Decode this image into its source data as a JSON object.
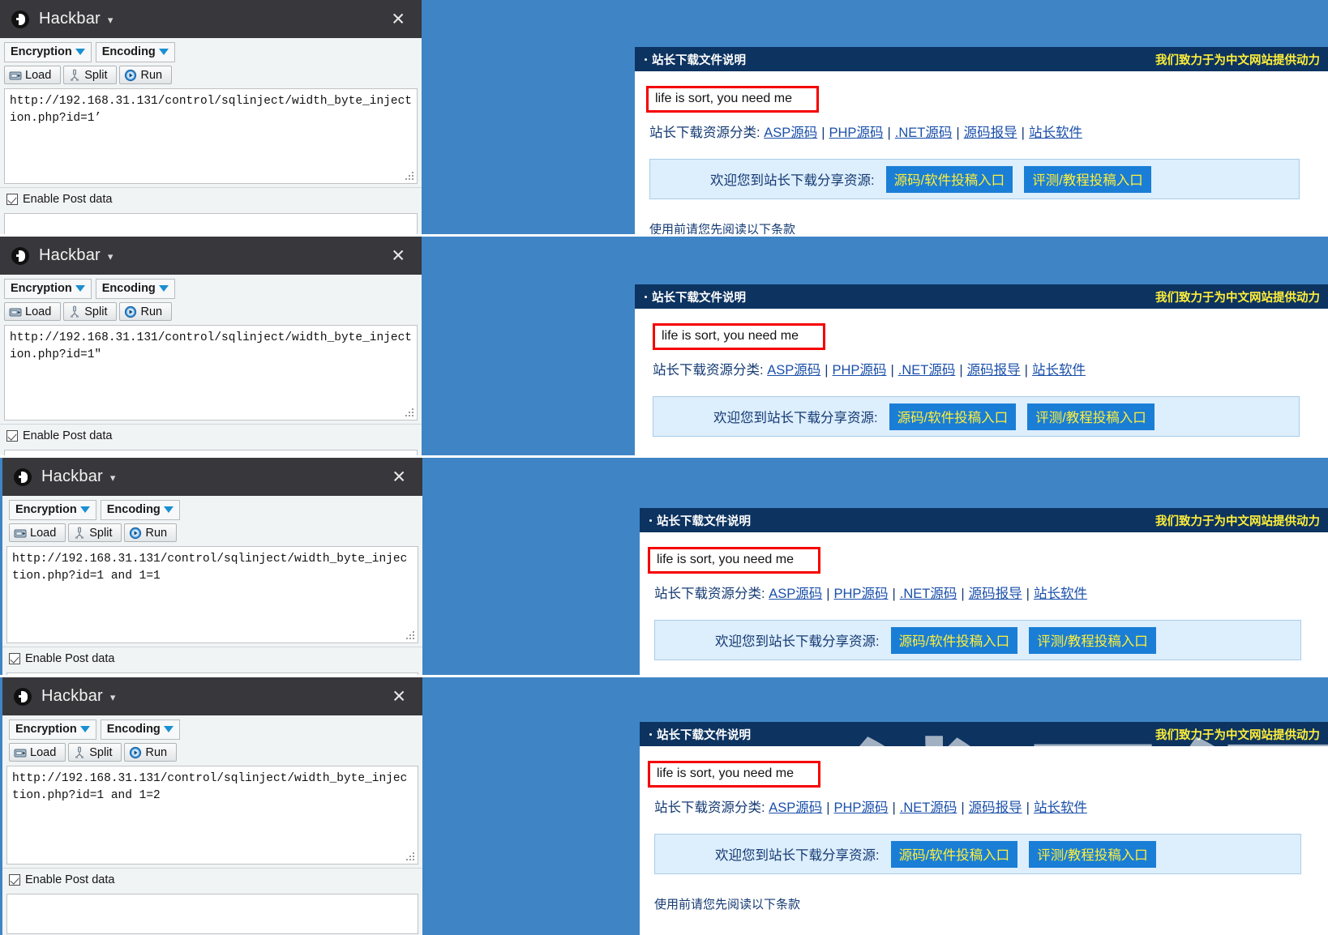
{
  "meta": {
    "background_color": "#3f85c6",
    "header_color": "#0d3360",
    "accent_yellow": "#ffef3a",
    "highlight_red": "#f50000"
  },
  "hackbar": {
    "title": "Hackbar",
    "caret_icon": "chevron-down-icon",
    "close_icon": "close-icon",
    "logo_icon": "hackbar-logo-icon",
    "dropdowns": [
      {
        "label": "Encryption",
        "icon": "caret-down-icon"
      },
      {
        "label": "Encoding",
        "icon": "caret-down-icon"
      }
    ],
    "buttons": [
      {
        "label": "Load",
        "icon": "load-icon"
      },
      {
        "label": "Split",
        "icon": "split-icon"
      },
      {
        "label": "Run",
        "icon": "run-icon"
      }
    ],
    "post_data_label": "Enable Post data",
    "post_data_checked": true
  },
  "webpage": {
    "header_title": "站长下载文件说明",
    "header_slogan": "我们致力于为中文网站提供动力",
    "flag_text": "life is sort, you need me",
    "category_label": "站长下载资源分类:",
    "category_links": [
      "ASP源码",
      "PHP源码",
      ".NET源码",
      "源码报导",
      "站长软件"
    ],
    "category_separator": "|",
    "promo_label": "欢迎您到站长下载分享资源:",
    "promo_buttons": [
      "源码/软件投稿入口",
      "评测/教程投稿入口"
    ],
    "terms_text": "使用前请您先阅读以下条款",
    "watermark_text": "浅男深"
  },
  "panels": [
    {
      "id": "panel-1",
      "url_value": "http://192.168.31.131/control/sqlinject/width_byte_injection.php?id=1’"
    },
    {
      "id": "panel-2",
      "url_value": "http://192.168.31.131/control/sqlinject/width_byte_injection.php?id=1″"
    },
    {
      "id": "panel-3",
      "url_value": "http://192.168.31.131/control/sqlinject/width_byte_injection.php?id=1 and 1=1"
    },
    {
      "id": "panel-4",
      "url_value": "http://192.168.31.131/control/sqlinject/width_byte_injection.php?id=1 and 1=2"
    }
  ]
}
